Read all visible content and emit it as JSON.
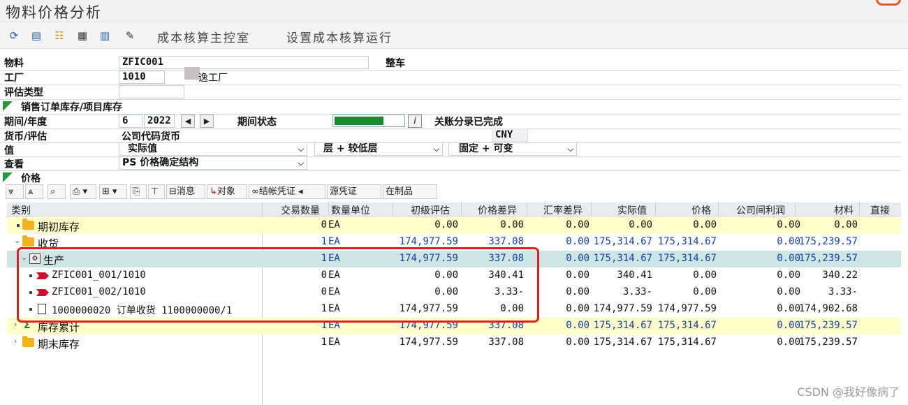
{
  "window": {
    "title": "物料价格分析"
  },
  "toolbar": {
    "icons": [
      "refresh-icon",
      "layout-icon",
      "hierarchy-icon",
      "save-layout-icon",
      "table-icon",
      "pen-icon"
    ],
    "btn_cockpit": "成本核算主控室",
    "btn_settings": "设置成本核算运行"
  },
  "form": {
    "material_label": "物料",
    "material_value": "ZFIC001",
    "material_desc": "整车",
    "plant_label": "工厂",
    "plant_value": "1010",
    "plant_desc": "逸工厂",
    "valuation_label": "评估类型",
    "valuation_value": "",
    "sales_stock_label": "销售订单库存/项目库存",
    "period_label": "期间/年度",
    "period_value": "6",
    "year_value": "2022",
    "period_status_label": "期间状态",
    "period_status_fraction": 0.7,
    "info_label": "i",
    "closing_status": "关账分录已完成",
    "currency_label": "货币/评估",
    "currency_value": "公司代码货币",
    "currency_code": "CNY",
    "value_label": "值",
    "value_option": "实际值",
    "level_option": "层 + 较低层",
    "fixed_option": "固定 + 可变",
    "view_label": "查看",
    "view_option": "PS 价格确定结构",
    "price_section_label": "价格"
  },
  "alv": {
    "btn_messages": "消息",
    "btn_objects": "对象",
    "btn_settlement": "结帐凭证",
    "btn_source": "源凭证",
    "btn_wip": "在制品"
  },
  "grid": {
    "columns": {
      "category": "类别",
      "qty": "交易数量",
      "unit": "数量单位",
      "prelim": "初级评估",
      "pricediff": "价格差异",
      "fxdiff": "汇率差异",
      "actual": "实际值",
      "price": "价格",
      "icprofit": "公司间利润",
      "material": "材料",
      "direct": "直接"
    },
    "rows": [
      {
        "label": "期初库存",
        "qty": "0",
        "unit": "EA",
        "prelim": "0.00",
        "pricediff": "0.00",
        "fxdiff": "0.00",
        "actual": "0.00",
        "price": "0.00",
        "icprofit": "0.00",
        "material": "0.00"
      },
      {
        "label": "收货",
        "qty": "1",
        "unit": "EA",
        "prelim": "174,977.59",
        "pricediff": "337.08",
        "fxdiff": "0.00",
        "actual": "175,314.67",
        "price": "175,314.67",
        "icprofit": "0.00",
        "material": "175,239.57"
      },
      {
        "label": "生产",
        "qty": "1",
        "unit": "EA",
        "prelim": "174,977.59",
        "pricediff": "337.08",
        "fxdiff": "0.00",
        "actual": "175,314.67",
        "price": "175,314.67",
        "icprofit": "0.00",
        "material": "175,239.57"
      },
      {
        "label": "ZFIC001_001/1010",
        "qty": "0",
        "unit": "EA",
        "prelim": "0.00",
        "pricediff": "340.41",
        "fxdiff": "0.00",
        "actual": "340.41",
        "price": "0.00",
        "icprofit": "0.00",
        "material": "340.22"
      },
      {
        "label": "ZFIC001_002/1010",
        "qty": "0",
        "unit": "EA",
        "prelim": "0.00",
        "pricediff": "3.33-",
        "fxdiff": "0.00",
        "actual": "3.33-",
        "price": "0.00",
        "icprofit": "0.00",
        "material": "3.33-"
      },
      {
        "label": "1000000020 订单收货 1100000000/1",
        "qty": "1",
        "unit": "EA",
        "prelim": "174,977.59",
        "pricediff": "0.00",
        "fxdiff": "0.00",
        "actual": "174,977.59",
        "price": "174,977.59",
        "icprofit": "0.00",
        "material": "174,902.68"
      },
      {
        "label": "库存累计",
        "qty": "1",
        "unit": "EA",
        "prelim": "174,977.59",
        "pricediff": "337.08",
        "fxdiff": "0.00",
        "actual": "175,314.67",
        "price": "175,314.67",
        "icprofit": "0.00",
        "material": "175,239.57"
      },
      {
        "label": "期末库存",
        "qty": "1",
        "unit": "EA",
        "prelim": "174,977.59",
        "pricediff": "337.08",
        "fxdiff": "0.00",
        "actual": "175,314.67",
        "price": "175,314.67",
        "icprofit": "0.00",
        "material": "175,239.57"
      }
    ]
  },
  "watermark": "CSDN @我好像病了",
  "colors": {
    "highlight": "#e02020",
    "yellow_row": "#fffdc8",
    "selected_row": "#cfe4e4",
    "blue_value": "#1440a8"
  }
}
